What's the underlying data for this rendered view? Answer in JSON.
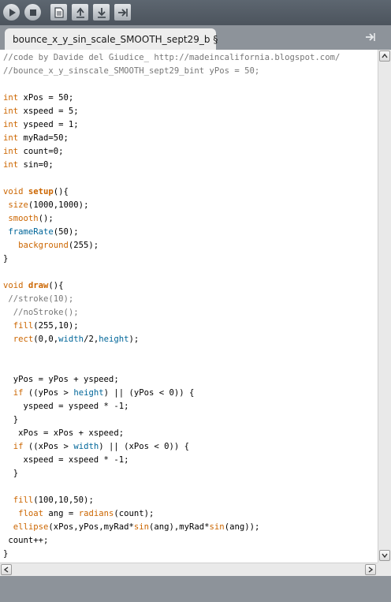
{
  "toolbar": {
    "buttons": [
      {
        "name": "run-button",
        "icon": "play-icon"
      },
      {
        "name": "stop-button",
        "icon": "stop-icon"
      },
      {
        "name": "new-button",
        "icon": "new-file-icon"
      },
      {
        "name": "open-button",
        "icon": "open-arrow-up-icon"
      },
      {
        "name": "save-button",
        "icon": "save-arrow-down-icon"
      },
      {
        "name": "export-button",
        "icon": "export-arrow-right-icon"
      }
    ]
  },
  "tab": {
    "label": "bounce_x_y_sin_scale_SMOOTH_sept29_b §"
  },
  "code_lines": [
    [
      {
        "c": "comment",
        "t": "//code by Davide del Giudice_ http://madeincalifornia.blogspot.com/"
      }
    ],
    [
      {
        "c": "comment",
        "t": "//bounce_x_y_sinscale_SMOOTH_sept29_bint yPos = 50;"
      }
    ],
    [
      {
        "c": "",
        "t": ""
      }
    ],
    [
      {
        "c": "kw-type",
        "t": "int"
      },
      {
        "c": "",
        "t": " xPos = 50;"
      }
    ],
    [
      {
        "c": "kw-type",
        "t": "int"
      },
      {
        "c": "",
        "t": " xspeed = 5;"
      }
    ],
    [
      {
        "c": "kw-type",
        "t": "int"
      },
      {
        "c": "",
        "t": " yspeed = 1;"
      }
    ],
    [
      {
        "c": "kw-type",
        "t": "int"
      },
      {
        "c": "",
        "t": " myRad=50;"
      }
    ],
    [
      {
        "c": "kw-type",
        "t": "int"
      },
      {
        "c": "",
        "t": " count=0;"
      }
    ],
    [
      {
        "c": "kw-type",
        "t": "int"
      },
      {
        "c": "",
        "t": " sin=0;"
      }
    ],
    [
      {
        "c": "",
        "t": ""
      }
    ],
    [
      {
        "c": "kw-type",
        "t": "void"
      },
      {
        "c": "",
        "t": " "
      },
      {
        "c": "kw-fn-bold",
        "t": "setup"
      },
      {
        "c": "",
        "t": "(){"
      }
    ],
    [
      {
        "c": "",
        "t": " "
      },
      {
        "c": "kw-func",
        "t": "size"
      },
      {
        "c": "",
        "t": "(1000,1000);"
      }
    ],
    [
      {
        "c": "",
        "t": " "
      },
      {
        "c": "kw-func",
        "t": "smooth"
      },
      {
        "c": "",
        "t": "();"
      }
    ],
    [
      {
        "c": "",
        "t": " "
      },
      {
        "c": "kw-const",
        "t": "frameRate"
      },
      {
        "c": "",
        "t": "(50);"
      }
    ],
    [
      {
        "c": "",
        "t": "   "
      },
      {
        "c": "kw-func",
        "t": "background"
      },
      {
        "c": "",
        "t": "(255);"
      }
    ],
    [
      {
        "c": "",
        "t": "}"
      }
    ],
    [
      {
        "c": "",
        "t": ""
      }
    ],
    [
      {
        "c": "kw-type",
        "t": "void"
      },
      {
        "c": "",
        "t": " "
      },
      {
        "c": "kw-fn-bold",
        "t": "draw"
      },
      {
        "c": "",
        "t": "(){"
      }
    ],
    [
      {
        "c": "",
        "t": " "
      },
      {
        "c": "comment",
        "t": "//stroke(10);"
      }
    ],
    [
      {
        "c": "",
        "t": "  "
      },
      {
        "c": "comment",
        "t": "//noStroke();"
      }
    ],
    [
      {
        "c": "",
        "t": "  "
      },
      {
        "c": "kw-func",
        "t": "fill"
      },
      {
        "c": "",
        "t": "(255,10);"
      }
    ],
    [
      {
        "c": "",
        "t": "  "
      },
      {
        "c": "kw-func",
        "t": "rect"
      },
      {
        "c": "",
        "t": "(0,0,"
      },
      {
        "c": "kw-const",
        "t": "width"
      },
      {
        "c": "",
        "t": "/2,"
      },
      {
        "c": "kw-const",
        "t": "height"
      },
      {
        "c": "",
        "t": ");"
      }
    ],
    [
      {
        "c": "",
        "t": ""
      }
    ],
    [
      {
        "c": "",
        "t": ""
      }
    ],
    [
      {
        "c": "",
        "t": "  yPos = yPos + yspeed;"
      }
    ],
    [
      {
        "c": "",
        "t": "  "
      },
      {
        "c": "kw-type",
        "t": "if"
      },
      {
        "c": "",
        "t": " ((yPos > "
      },
      {
        "c": "kw-const",
        "t": "height"
      },
      {
        "c": "",
        "t": ") || (yPos < 0)) {"
      }
    ],
    [
      {
        "c": "",
        "t": "    yspeed = yspeed * -1;"
      }
    ],
    [
      {
        "c": "",
        "t": "  }"
      }
    ],
    [
      {
        "c": "",
        "t": "   xPos = xPos + xspeed;"
      }
    ],
    [
      {
        "c": "",
        "t": "  "
      },
      {
        "c": "kw-type",
        "t": "if"
      },
      {
        "c": "",
        "t": " ((xPos > "
      },
      {
        "c": "kw-const",
        "t": "width"
      },
      {
        "c": "",
        "t": ") || (xPos < 0)) {"
      }
    ],
    [
      {
        "c": "",
        "t": "    xspeed = xspeed * -1;"
      }
    ],
    [
      {
        "c": "",
        "t": "  }"
      }
    ],
    [
      {
        "c": "",
        "t": ""
      }
    ],
    [
      {
        "c": "",
        "t": "  "
      },
      {
        "c": "kw-func",
        "t": "fill"
      },
      {
        "c": "",
        "t": "(100,10,50);"
      }
    ],
    [
      {
        "c": "",
        "t": "   "
      },
      {
        "c": "kw-type",
        "t": "float"
      },
      {
        "c": "",
        "t": " ang = "
      },
      {
        "c": "kw-func",
        "t": "radians"
      },
      {
        "c": "",
        "t": "(count);"
      }
    ],
    [
      {
        "c": "",
        "t": "  "
      },
      {
        "c": "kw-func",
        "t": "ellipse"
      },
      {
        "c": "",
        "t": "(xPos,yPos,myRad*"
      },
      {
        "c": "kw-func",
        "t": "sin"
      },
      {
        "c": "",
        "t": "(ang),myRad*"
      },
      {
        "c": "kw-func",
        "t": "sin"
      },
      {
        "c": "",
        "t": "(ang));"
      }
    ],
    [
      {
        "c": "",
        "t": " count++;"
      }
    ],
    [
      {
        "c": "",
        "t": "}"
      }
    ]
  ]
}
